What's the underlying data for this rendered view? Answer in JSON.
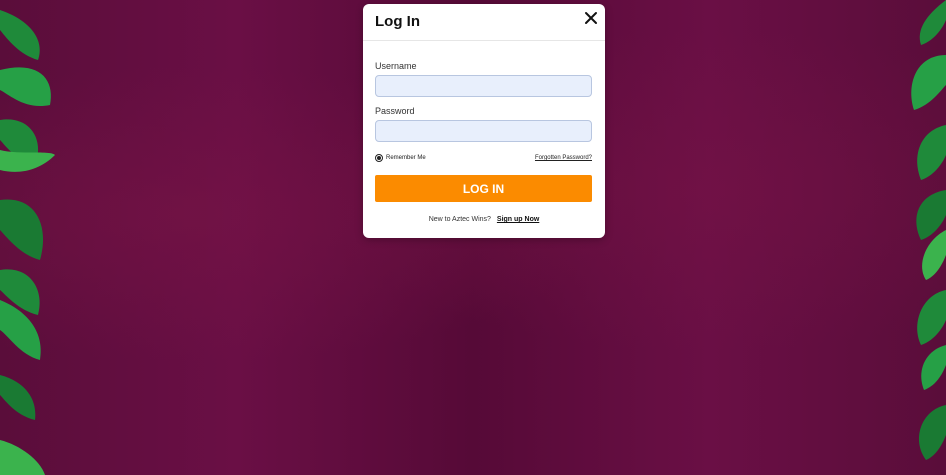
{
  "modal": {
    "title": "Log In",
    "close_icon": "close-icon",
    "username": {
      "label": "Username",
      "value": "",
      "placeholder": ""
    },
    "password": {
      "label": "Password",
      "value": "",
      "placeholder": ""
    },
    "remember_me": {
      "label": "Remember Me",
      "checked": true
    },
    "forgot_password_label": "Forgotten Password?",
    "login_button_label": "LOG IN",
    "signup_prompt": "New to Aztec Wins?",
    "signup_link_label": "Sign up Now"
  },
  "colors": {
    "background": "#5a0d3a",
    "primary_button": "#fb8b00",
    "input_background": "#e8effc",
    "foliage": "#1f8a3a"
  }
}
